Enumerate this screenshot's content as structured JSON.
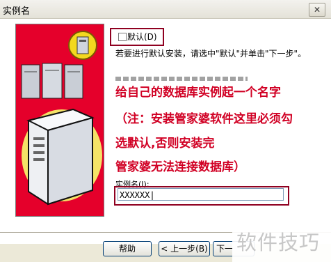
{
  "window": {
    "title": "实例名",
    "close_label": "✕"
  },
  "checkbox": {
    "label": "默认(D)",
    "checked": false
  },
  "instruction": "若要进行默认安装，请选中\"默认\"并单击\"下一步\"。",
  "annotation": {
    "lines": [
      "给自己的数据库实例起一个名字",
      "（注：安装管家婆软件这里必须勾",
      "选默认,否则安装完",
      "管家婆无法连接数据库）"
    ],
    "color": "#d10024"
  },
  "instance_name": {
    "label": "实例名(I):",
    "value": "XXXXXX|"
  },
  "buttons": {
    "help": "帮助",
    "back": "< 上一步(B)",
    "next": "下一"
  },
  "watermark": "软件技巧",
  "colors": {
    "panel_red": "#e5002b",
    "highlight_border": "#8f0020",
    "dialog_bg": "#ece9d8"
  }
}
